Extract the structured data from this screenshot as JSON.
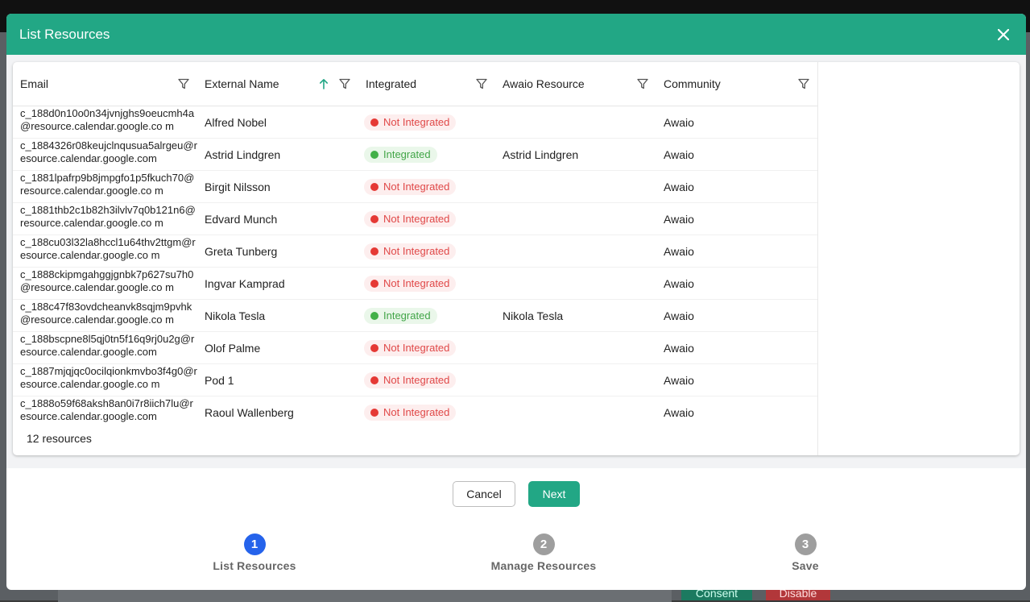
{
  "background": {
    "consent_label": "Consent",
    "disable_label": "Disable"
  },
  "modal": {
    "title": "List Resources",
    "close_icon": "close-icon"
  },
  "table": {
    "columns": [
      {
        "label": "Email",
        "filter": true
      },
      {
        "label": "External Name",
        "filter": true,
        "sort": "ascending"
      },
      {
        "label": "Integrated",
        "filter": true
      },
      {
        "label": "Awaio Resource",
        "filter": true
      },
      {
        "label": "Community",
        "filter": true
      }
    ],
    "rows": [
      {
        "email": "c_188d0n10o0n34jvnjghs9oeucmh4a@resource.calendar.google.co m",
        "name": "Alfred Nobel",
        "integrated": "Not Integrated",
        "status": "off",
        "resource": "",
        "community": "Awaio"
      },
      {
        "email": "c_1884326r08keujclnqusua5alrgeu@resource.calendar.google.com",
        "name": "Astrid Lindgren",
        "integrated": "Integrated",
        "status": "on",
        "resource": "Astrid Lindgren",
        "community": "Awaio"
      },
      {
        "email": "c_1881lpafrp9b8jmpgfo1p5fkuch70@resource.calendar.google.co m",
        "name": "Birgit Nilsson",
        "integrated": "Not Integrated",
        "status": "off",
        "resource": "",
        "community": "Awaio"
      },
      {
        "email": "c_1881thb2c1b82h3ilvlv7q0b121n6@resource.calendar.google.co m",
        "name": "Edvard Munch",
        "integrated": "Not Integrated",
        "status": "off",
        "resource": "",
        "community": "Awaio"
      },
      {
        "email": "c_188cu03l32la8hccl1u64thv2ttgm@resource.calendar.google.co m",
        "name": "Greta Tunberg",
        "integrated": "Not Integrated",
        "status": "off",
        "resource": "",
        "community": "Awaio"
      },
      {
        "email": "c_1888ckipmgahggjgnbk7p627su7h0@resource.calendar.google.co m",
        "name": "Ingvar Kamprad",
        "integrated": "Not Integrated",
        "status": "off",
        "resource": "",
        "community": "Awaio"
      },
      {
        "email": "c_188c47f83ovdcheanvk8sqjm9pvhk@resource.calendar.google.co m",
        "name": "Nikola Tesla",
        "integrated": "Integrated",
        "status": "on",
        "resource": "Nikola Tesla",
        "community": "Awaio"
      },
      {
        "email": "c_188bscpne8l5qj0tn5f16q9rj0u2g@resource.calendar.google.com",
        "name": "Olof Palme",
        "integrated": "Not Integrated",
        "status": "off",
        "resource": "",
        "community": "Awaio"
      },
      {
        "email": "c_1887mjqjqc0ocilqionkmvbo3f4g0@resource.calendar.google.co m",
        "name": "Pod 1",
        "integrated": "Not Integrated",
        "status": "off",
        "resource": "",
        "community": "Awaio"
      },
      {
        "email": "c_1888o59f68aksh8an0i7r8iich7lu@resource.calendar.google.com",
        "name": "Raoul Wallenberg",
        "integrated": "Not Integrated",
        "status": "off",
        "resource": "",
        "community": "Awaio"
      }
    ],
    "footer": "12 resources"
  },
  "actions": {
    "cancel_label": "Cancel",
    "next_label": "Next"
  },
  "stepper": {
    "steps": [
      {
        "number": "1",
        "label": "List Resources",
        "active": true
      },
      {
        "number": "2",
        "label": "Manage Resources",
        "active": false
      },
      {
        "number": "3",
        "label": "Save",
        "active": false
      }
    ]
  },
  "colors": {
    "brand": "#22a785",
    "active_step": "#2563eb",
    "not_integrated": "#e53935",
    "integrated": "#43b049"
  }
}
